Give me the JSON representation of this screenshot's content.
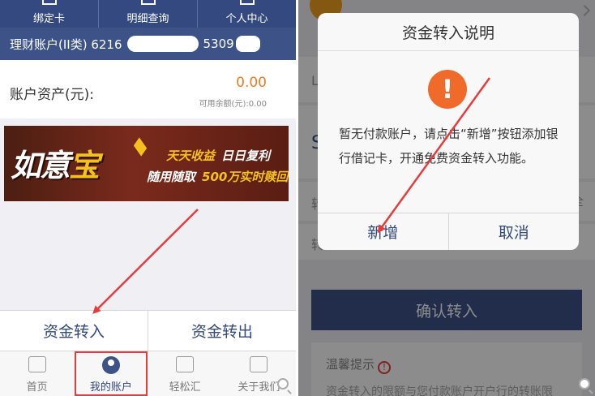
{
  "left_screen": {
    "top_nav": [
      "绑定卡",
      "明细查询",
      "个人中心"
    ],
    "account": {
      "prefix": "理财账户(II类) 6216",
      "suffix": "5309"
    },
    "assets": {
      "label": "账户资产(元):",
      "value": "0.00",
      "available": "可用余额(元):0.00"
    },
    "banner": {
      "title_part1": "如意",
      "title_part2": "宝",
      "line1a": "天天收益",
      "line1b": "日日复利",
      "line2a": "随用随取",
      "line2b": "500万实时赎回"
    },
    "actions": {
      "transfer_in": "资金转入",
      "transfer_out": "资金转出"
    },
    "tabs": [
      "首页",
      "我的账户",
      "轻松汇",
      "关于我们"
    ],
    "active_tab": "我的账户"
  },
  "right_screen": {
    "dialog": {
      "title": "资金转入说明",
      "message": "暂无付款账户，请点击“新增”按钮添加银行借记卡，开通免费资金转入功能。",
      "btn_add": "新增",
      "btn_cancel": "取消"
    },
    "background": {
      "letter_a": "L",
      "letter_b": "S",
      "letter_c": "转",
      "letter_d": "转",
      "side_text": "全",
      "confirm": "确认转入",
      "tips_title": "温馨提示",
      "tips_text": "资金转入的限额与您付款账户开户行的转账限"
    }
  },
  "colors": {
    "brand": "#33497f",
    "accent": "#f07a1e",
    "arrow": "#e53c3c"
  }
}
